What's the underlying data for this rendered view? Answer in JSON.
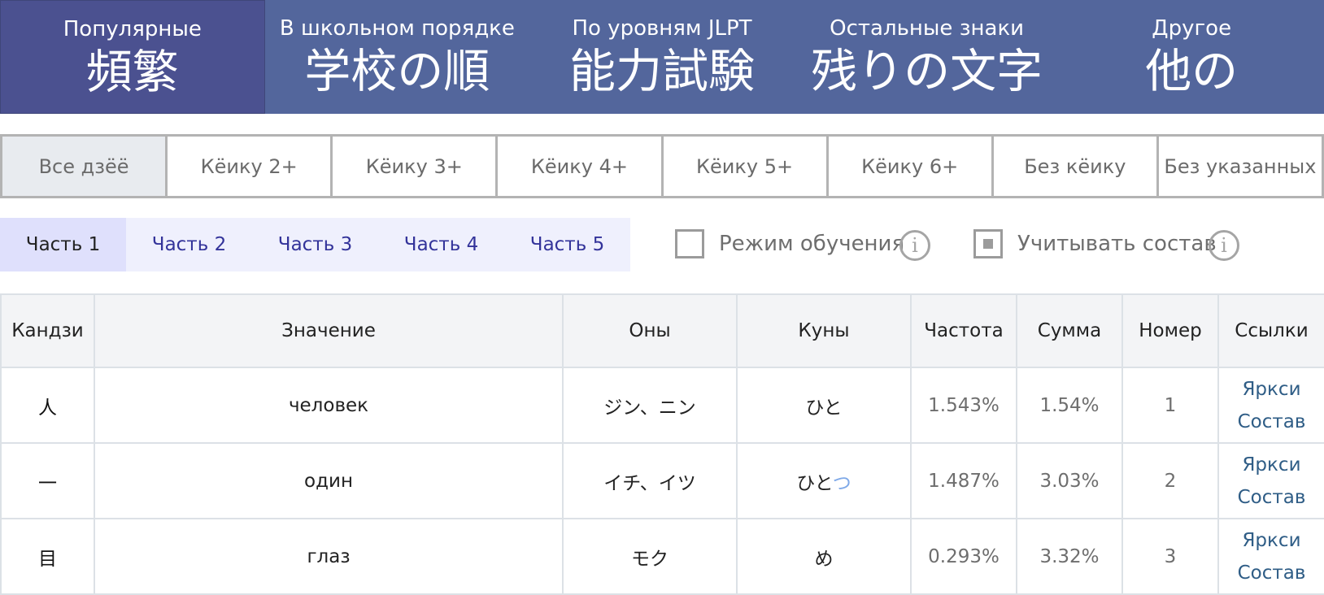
{
  "topnav": [
    {
      "sub": "Популярные",
      "big": "頻繁",
      "active": true
    },
    {
      "sub": "В школьном порядке",
      "big": "学校の順",
      "active": false
    },
    {
      "sub": "По уровням JLPT",
      "big": "能力試験",
      "active": false
    },
    {
      "sub": "Остальные знаки",
      "big": "残りの文字",
      "active": false
    },
    {
      "sub": "Другое",
      "big": "他の",
      "active": false
    }
  ],
  "grades": [
    "Все дзёё",
    "Кёику 2+",
    "Кёику 3+",
    "Кёику 4+",
    "Кёику 5+",
    "Кёику 6+",
    "Без кёику",
    "Без указанных"
  ],
  "grades_active": "Все дзёё",
  "parts": [
    "Часть 1",
    "Часть 2",
    "Часть 3",
    "Часть 4",
    "Часть 5"
  ],
  "parts_active": "Часть 1",
  "toggles": {
    "learning_mode": {
      "label": "Режим обучения",
      "checked": false
    },
    "consider_composition": {
      "label": "Учитывать состав",
      "checked": true
    },
    "info_symbol": "i"
  },
  "table": {
    "headers": {
      "kanji": "Кандзи",
      "meaning": "Значение",
      "on": "Оны",
      "kun": "Куны",
      "frequency": "Частота",
      "sum": "Сумма",
      "number": "Номер",
      "links": "Ссылки"
    },
    "rows": [
      {
        "kanji": "人",
        "meaning": "человек",
        "on": "ジン、ニン",
        "kun": "ひと",
        "kun_okurigana": "",
        "frequency": "1.543%",
        "sum": "1.54%",
        "number": "1",
        "link1": "Яркси",
        "link2": "Состав"
      },
      {
        "kanji": "一",
        "meaning": "один",
        "on": "イチ、イツ",
        "kun": "ひと",
        "kun_okurigana": "つ",
        "frequency": "1.487%",
        "sum": "3.03%",
        "number": "2",
        "link1": "Яркси",
        "link2": "Состав"
      },
      {
        "kanji": "目",
        "meaning": "глаз",
        "on": "モク",
        "kun": "め",
        "kun_okurigana": "",
        "frequency": "0.293%",
        "sum": "3.32%",
        "number": "3",
        "link1": "Яркси",
        "link2": "Состав"
      }
    ]
  },
  "colors": {
    "nav_bg": "#53669c",
    "nav_active": "#4b5190",
    "link": "#2f5d86",
    "part_link": "#33339a",
    "okurigana": "#7fa9e8"
  }
}
